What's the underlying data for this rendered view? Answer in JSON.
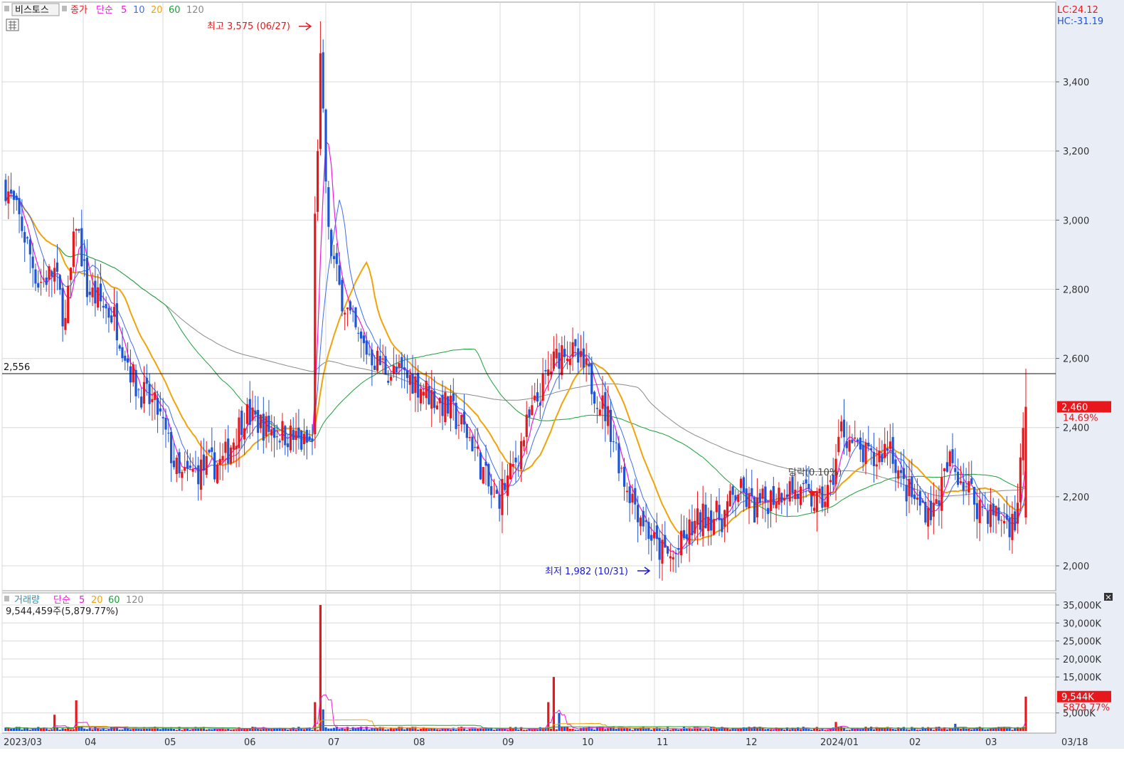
{
  "colors": {
    "up": "#e8171b",
    "down": "#1d55d6",
    "ma5": "#ee1bd7",
    "ma10": "#3d6cf0",
    "ma20": "#f0a30a",
    "ma60": "#1aa038",
    "ma120": "#8a8a8a",
    "grid": "#d9d9d9",
    "axis_bg": "#e9eef6"
  },
  "price_panel": {
    "stock_name": "비스토스",
    "legend": [
      "종가",
      "단순",
      "5",
      "10",
      "20",
      "60",
      "120"
    ],
    "lc": "LC:24.12",
    "hc": "HC:-31.19",
    "high_annotation": "최고 3,575 (06/27)",
    "low_annotation": "최저 1,982 (10/31)",
    "ref_line_label": "2,556",
    "current_price": "2,460",
    "current_change": "14.69%",
    "event_label": "당락(0.10%)",
    "y_ticks": [
      "3,400",
      "3,200",
      "3,000",
      "2,800",
      "2,600",
      "2,400",
      "2,200",
      "2,000"
    ]
  },
  "volume_panel": {
    "legend": [
      "거래량",
      "단순",
      "5",
      "20",
      "60",
      "120"
    ],
    "summary": "9,544,459주(5,879.77%)",
    "current_volume": "9,544K",
    "current_pct": "5879.77%",
    "y_ticks": [
      "35,000K",
      "30,000K",
      "25,000K",
      "20,000K",
      "15,000K",
      "5,000K"
    ]
  },
  "x_axis_labels": [
    "2023/03",
    "04",
    "05",
    "06",
    "07",
    "08",
    "09",
    "10",
    "11",
    "12",
    "2024/01",
    "02",
    "03",
    "03/18"
  ],
  "chart_data": [
    {
      "type": "line",
      "title": "",
      "note": "daily close prices (approximate), candlestick chart",
      "x": [
        "2023/03",
        "04",
        "05",
        "06",
        "07",
        "08",
        "09",
        "10",
        "11",
        "12",
        "2024/01",
        "02",
        "03"
      ],
      "series": [
        {
          "name": "종가",
          "values": [
            3100,
            2800,
            2300,
            2420,
            2700,
            2500,
            2350,
            2400,
            2050,
            2180,
            2260,
            2280,
            2140,
            2460
          ]
        }
      ],
      "y_high": 3575,
      "y_low": 1982,
      "reference_line": 2556,
      "last": 2460,
      "ylim": [
        1930,
        3580
      ]
    },
    {
      "type": "bar",
      "title": "",
      "note": "daily volume (thousands of shares)",
      "series": [
        {
          "name": "거래량",
          "values": [
            9544
          ]
        }
      ],
      "ylim": [
        0,
        36500
      ]
    }
  ]
}
